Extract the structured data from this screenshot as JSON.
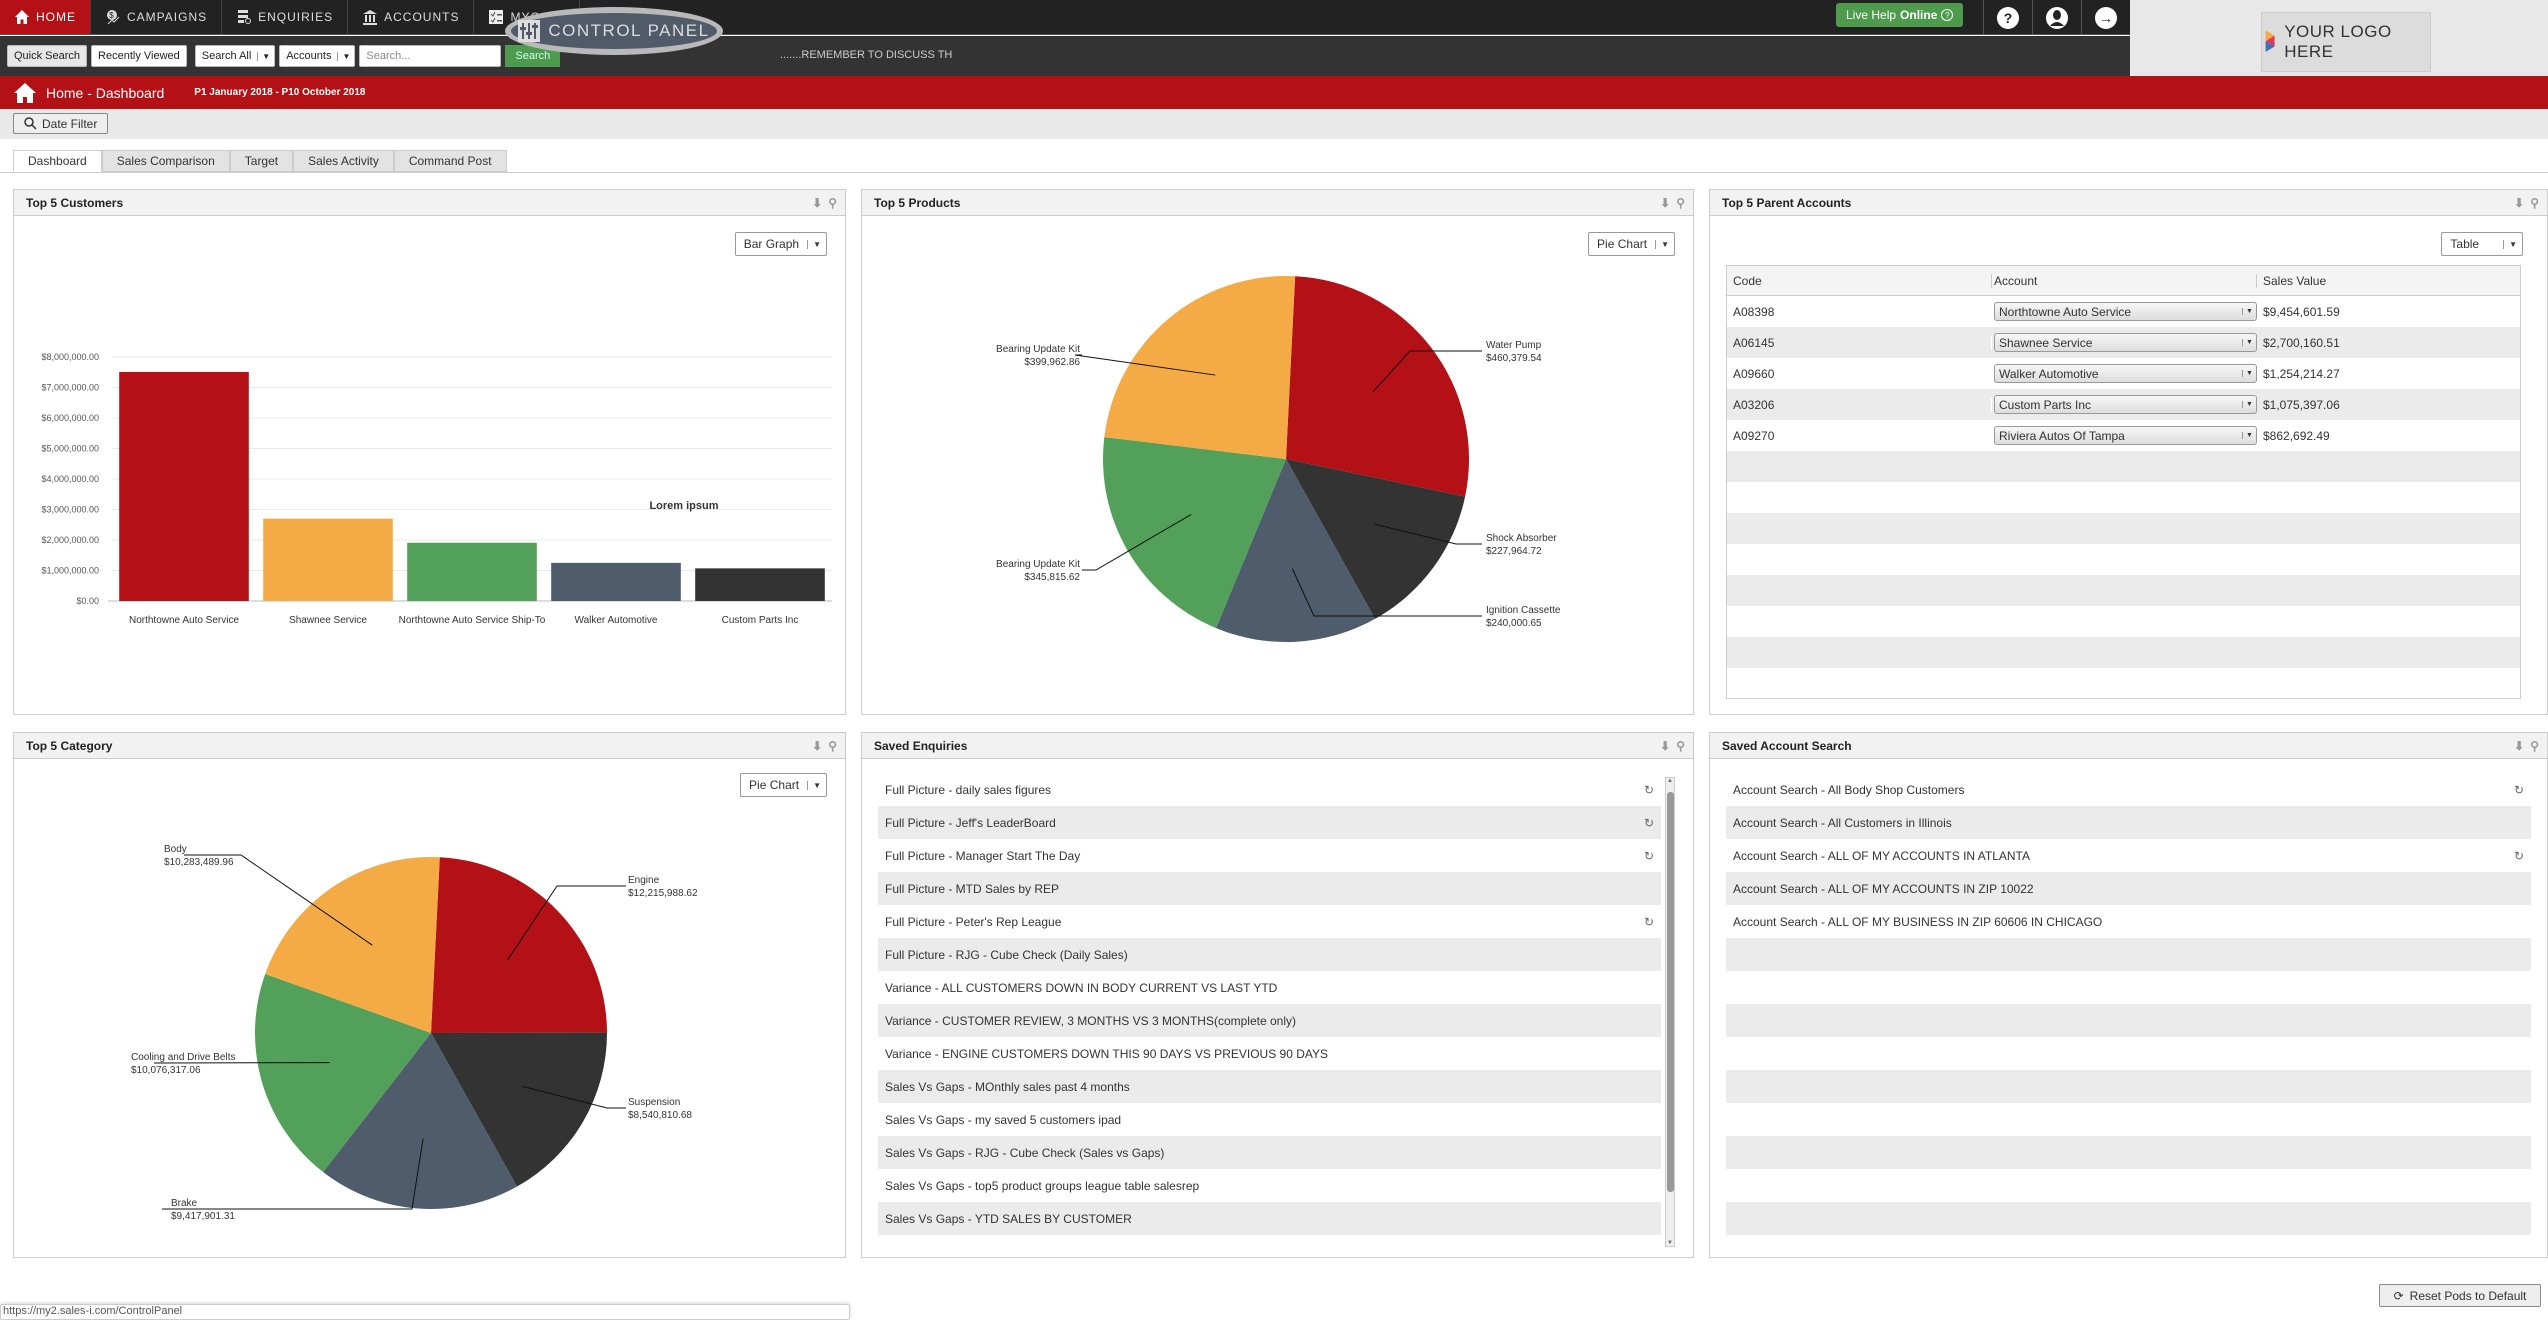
{
  "topnav": {
    "items": [
      {
        "label": "HOME",
        "icon": "home-icon",
        "active": true
      },
      {
        "label": "CAMPAIGNS",
        "icon": "campaigns-icon"
      },
      {
        "label": "ENQUIRIES",
        "icon": "enquiries-icon"
      },
      {
        "label": "ACCOUNTS",
        "icon": "bank-icon"
      },
      {
        "label": "MYCALL",
        "icon": "checklist-icon"
      }
    ],
    "control_panel": "CONTROL PANEL",
    "live_help": "Live Help",
    "live_help_status": "Online"
  },
  "subbar": {
    "quick_search": "Quick Search",
    "recently_viewed": "Recently Viewed",
    "search_scope": "Search All",
    "search_type": "Accounts",
    "search_placeholder": "Search...",
    "search_button": "Search",
    "ticker": ".......REMEMBER TO DISCUSS TH"
  },
  "logo": {
    "text": "YOUR LOGO HERE"
  },
  "header": {
    "title": "Home - Dashboard",
    "date_range": "P1 January 2018 - P10 October 2018"
  },
  "date_filter": "Date Filter",
  "tabs": [
    "Dashboard",
    "Sales Comparison",
    "Target",
    "Sales Activity",
    "Command Post"
  ],
  "colors": {
    "red": "#b31116",
    "orange": "#f4ab45",
    "green": "#52a05a",
    "slate": "#4f5c6c",
    "dark": "#333333"
  },
  "pods": {
    "customers": {
      "title": "Top 5 Customers",
      "view": "Bar Graph",
      "annotation": "Lorem ipsum"
    },
    "products": {
      "title": "Top 5 Products",
      "view": "Pie Chart"
    },
    "parent_accounts": {
      "title": "Top 5 Parent Accounts",
      "view": "Table",
      "columns": [
        "Code",
        "Account",
        "Sales Value"
      ],
      "rows": [
        {
          "code": "A08398",
          "account": "Northtowne Auto Service",
          "value": "$9,454,601.59"
        },
        {
          "code": "A06145",
          "account": "Shawnee Service",
          "value": "$2,700,160.51"
        },
        {
          "code": "A09660",
          "account": "Walker Automotive",
          "value": "$1,254,214.27"
        },
        {
          "code": "A03206",
          "account": "Custom Parts Inc",
          "value": "$1,075,397.06"
        },
        {
          "code": "A09270",
          "account": "Riviera Autos Of Tampa",
          "value": "$862,692.49"
        }
      ]
    },
    "category": {
      "title": "Top 5 Category",
      "view": "Pie Chart"
    },
    "saved_enquiries": {
      "title": "Saved Enquiries",
      "items": [
        {
          "label": "Full Picture - daily sales figures",
          "refresh": true
        },
        {
          "label": "Full Picture - Jeff's LeaderBoard",
          "refresh": true
        },
        {
          "label": "Full Picture - Manager Start The Day",
          "refresh": true
        },
        {
          "label": "Full Picture - MTD Sales by REP",
          "refresh": false
        },
        {
          "label": "Full Picture - Peter's Rep League",
          "refresh": true
        },
        {
          "label": "Full Picture - RJG - Cube Check (Daily Sales)",
          "refresh": false
        },
        {
          "label": "Variance - ALL CUSTOMERS DOWN IN BODY CURRENT VS LAST YTD",
          "refresh": false
        },
        {
          "label": "Variance - CUSTOMER REVIEW, 3 MONTHS VS 3 MONTHS(complete only)",
          "refresh": false
        },
        {
          "label": "Variance - ENGINE CUSTOMERS DOWN THIS 90 DAYS VS PREVIOUS 90 DAYS",
          "refresh": false
        },
        {
          "label": "Sales Vs Gaps - MOnthly sales past 4 months",
          "refresh": false
        },
        {
          "label": "Sales Vs Gaps - my saved 5 customers ipad",
          "refresh": false
        },
        {
          "label": "Sales Vs Gaps - RJG - Cube Check (Sales vs Gaps)",
          "refresh": false
        },
        {
          "label": "Sales Vs Gaps - top5 product groups league table salesrep",
          "refresh": false
        },
        {
          "label": "Sales Vs Gaps - YTD SALES BY CUSTOMER",
          "refresh": false
        }
      ]
    },
    "saved_account_search": {
      "title": "Saved Account Search",
      "items": [
        {
          "label": "Account Search - All Body Shop Customers",
          "refresh": true
        },
        {
          "label": "Account Search - All Customers in Illinois",
          "refresh": false
        },
        {
          "label": "Account Search - ALL OF MY ACCOUNTS IN ATLANTA",
          "refresh": true
        },
        {
          "label": "Account Search - ALL OF MY ACCOUNTS IN ZIP 10022",
          "refresh": false
        },
        {
          "label": "Account Search - ALL OF MY BUSINESS IN ZIP 60606 IN CHICAGO",
          "refresh": false
        },
        {
          "label": "",
          "refresh": false
        },
        {
          "label": "",
          "refresh": false
        },
        {
          "label": "",
          "refresh": false
        },
        {
          "label": "",
          "refresh": false
        },
        {
          "label": "",
          "refresh": false
        },
        {
          "label": "",
          "refresh": false
        },
        {
          "label": "",
          "refresh": false
        },
        {
          "label": "",
          "refresh": false
        },
        {
          "label": "",
          "refresh": false
        }
      ]
    }
  },
  "status_url": "https://my2.sales-i.com/ControlPanel",
  "reset_button": "Reset Pods to Default",
  "chart_data": [
    {
      "id": "top5-customers",
      "type": "bar",
      "title": "Top 5 Customers",
      "categories": [
        "Northtowne Auto Service",
        "Shawnee Service",
        "Northtowne Auto Service Ship-To",
        "Walker Automotive",
        "Custom Parts Inc"
      ],
      "values": [
        7510000,
        2700000,
        1910000,
        1250000,
        1070000
      ],
      "colors": [
        "#b31116",
        "#f4ab45",
        "#52a05a",
        "#4f5c6c",
        "#333333"
      ],
      "yticks": [
        "$0.00",
        "$1,000,000.00",
        "$2,000,000.00",
        "$3,000,000.00",
        "$4,000,000.00",
        "$5,000,000.00",
        "$6,000,000.00",
        "$7,000,000.00",
        "$8,000,000.00"
      ],
      "ylim": [
        0,
        8000000
      ],
      "xlabel": "",
      "ylabel": "",
      "grid": true,
      "annotation": "Lorem ipsum"
    },
    {
      "id": "top5-products",
      "type": "pie",
      "title": "Top 5 Products",
      "slices": [
        {
          "label": "Water Pump",
          "value": 460379.54,
          "text": "$460,379.54",
          "color": "#b31116"
        },
        {
          "label": "Shock Absorber",
          "value": 227964.72,
          "text": "$227,964.72",
          "color": "#333333"
        },
        {
          "label": "Ignition Cassette",
          "value": 240000.65,
          "text": "$240,000.65",
          "color": "#4f5c6c"
        },
        {
          "label": "Bearing Update Kit",
          "value": 345815.62,
          "text": "$345,815.62",
          "color": "#52a05a"
        },
        {
          "label": "Bearing Update Kit",
          "value": 399962.86,
          "text": "$399,962.86",
          "color": "#f4ab45"
        }
      ]
    },
    {
      "id": "top5-category",
      "type": "pie",
      "title": "Top 5 Category",
      "slices": [
        {
          "label": "Engine",
          "value": 12215988.62,
          "text": "$12,215,988.62",
          "color": "#b31116"
        },
        {
          "label": "Suspension",
          "value": 8540810.68,
          "text": "$8,540,810.68",
          "color": "#333333"
        },
        {
          "label": "Brake",
          "value": 9417901.31,
          "text": "$9,417,901.31",
          "color": "#4f5c6c"
        },
        {
          "label": "Cooling and Drive Belts",
          "value": 10076317.06,
          "text": "$10,076,317.06",
          "color": "#52a05a"
        },
        {
          "label": "Body",
          "value": 10283489.96,
          "text": "$10,283,489.96",
          "color": "#f4ab45"
        }
      ]
    }
  ]
}
